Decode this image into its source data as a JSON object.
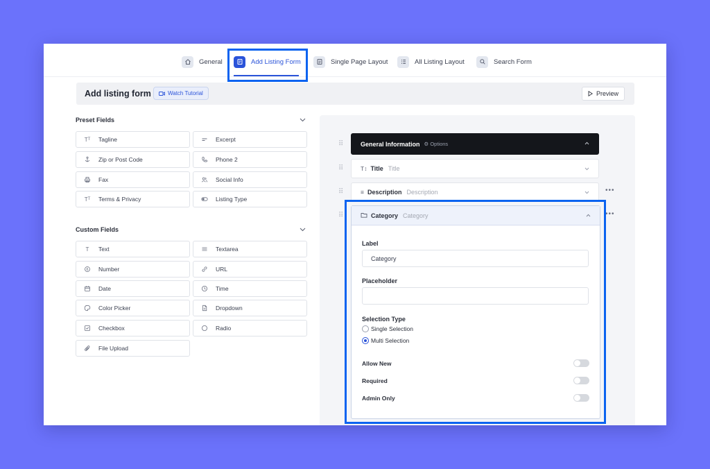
{
  "tabs": [
    {
      "label": "General",
      "icon": "home-icon"
    },
    {
      "label": "Add Listing Form",
      "icon": "form-icon",
      "active": true
    },
    {
      "label": "Single Page Layout",
      "icon": "layout-icon"
    },
    {
      "label": "All Listing Layout",
      "icon": "list-icon"
    },
    {
      "label": "Search Form",
      "icon": "search-icon"
    }
  ],
  "header": {
    "title": "Add listing form",
    "watch_label": "Watch Tutorial",
    "preview_label": "Preview"
  },
  "preset": {
    "title": "Preset Fields",
    "fields": [
      "Tagline",
      "Excerpt",
      "Zip or Post Code",
      "Phone 2",
      "Fax",
      "Social Info",
      "Terms & Privacy",
      "Listing Type"
    ]
  },
  "custom": {
    "title": "Custom Fields",
    "fields": [
      "Text",
      "Textarea",
      "Number",
      "URL",
      "Date",
      "Time",
      "Color Picker",
      "Dropdown",
      "Checkbox",
      "Radio",
      "File Upload"
    ]
  },
  "builder": {
    "group": {
      "name": "General Information",
      "options": "Options"
    },
    "rows": [
      {
        "name": "Title",
        "sub": "Title"
      },
      {
        "name": "Description",
        "sub": "Description"
      }
    ],
    "category": {
      "name": "Category",
      "sub": "Category",
      "label_label": "Label",
      "label_value": "Category",
      "placeholder_label": "Placeholder",
      "placeholder_value": "",
      "selection_label": "Selection Type",
      "options": [
        "Single Selection",
        "Multi Selection"
      ],
      "selected": "Multi Selection",
      "toggles": [
        "Allow New",
        "Required",
        "Admin Only"
      ]
    }
  },
  "colors": {
    "accent": "#2a53d9",
    "highlight": "#0b63f0",
    "background": "#6b72fb"
  }
}
